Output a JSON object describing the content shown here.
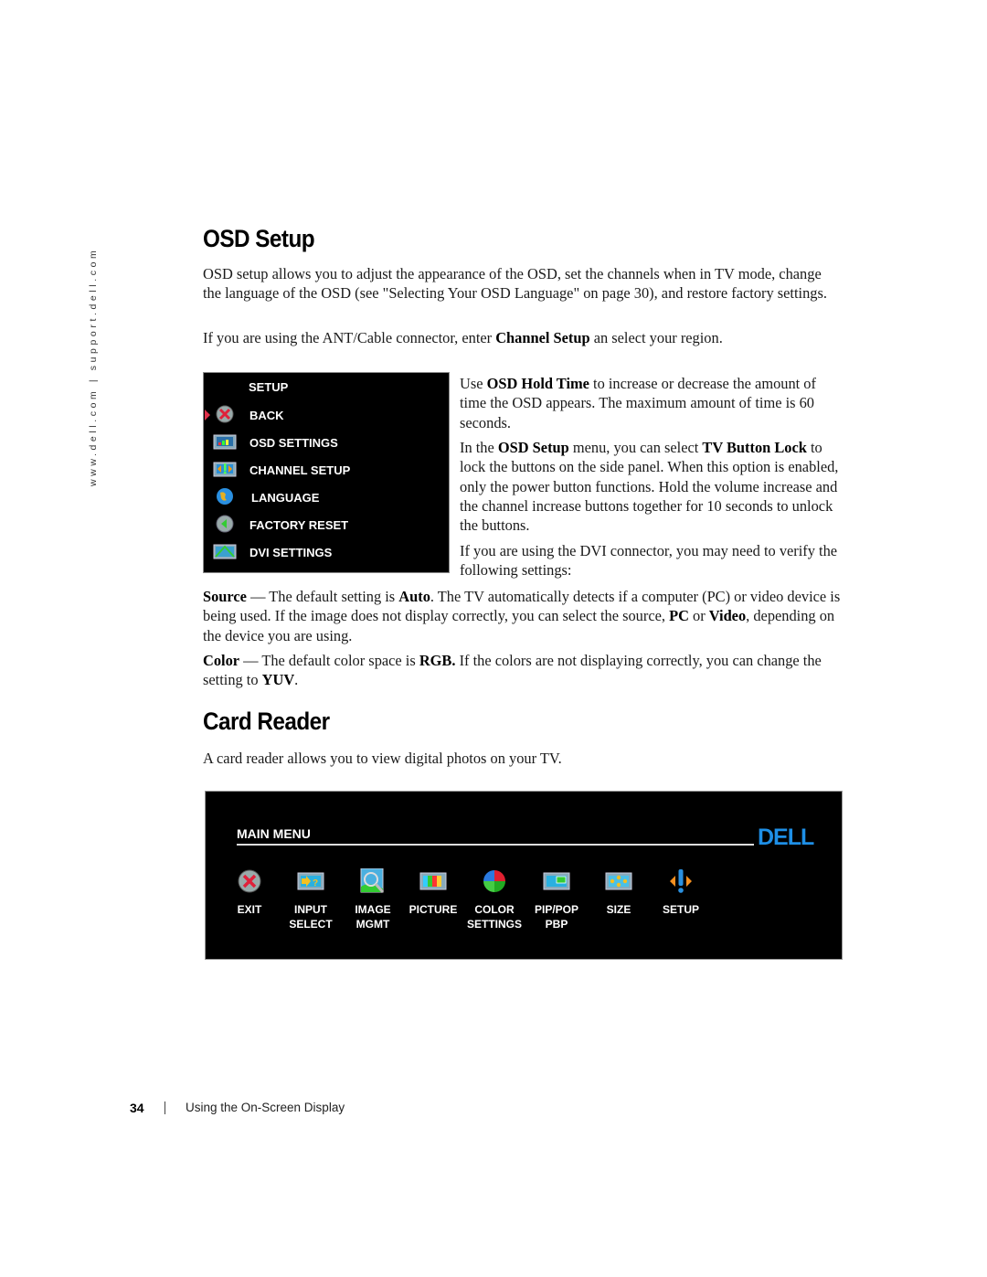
{
  "sidebar": {
    "url_text": "www.dell.com | support.dell.com"
  },
  "osd_setup": {
    "heading": "OSD Setup",
    "intro": "OSD setup allows you to adjust the appearance of the OSD, set the channels when in TV mode, change the language of the OSD (see \"Selecting Your OSD Language\" on page 30), and restore factory settings.",
    "ant_cable": {
      "pre": "If you are using the ANT/Cable connector, enter ",
      "bold": "Channel Setup",
      "post": " an select your region."
    },
    "menu": {
      "title": "SETUP",
      "items": [
        {
          "label": "BACK",
          "icon": "back-x-icon",
          "selected": true
        },
        {
          "label": "OSD SETTINGS",
          "icon": "osd-settings-icon"
        },
        {
          "label": "CHANNEL SETUP",
          "icon": "channel-setup-icon"
        },
        {
          "label": "LANGUAGE",
          "icon": "globe-icon"
        },
        {
          "label": "FACTORY RESET",
          "icon": "factory-reset-icon"
        },
        {
          "label": "DVI SETTINGS",
          "icon": "dvi-settings-icon"
        }
      ]
    },
    "hold_time": {
      "pre": "Use ",
      "bold": "OSD Hold Time",
      "post": " to increase or decrease the amount of time the OSD appears. The maximum amount of time is 60 seconds."
    },
    "button_lock": {
      "pre": "In the ",
      "bold1": "OSD Setup",
      "mid": " menu, you can select ",
      "bold2": "TV Button Lock",
      "post": " to lock the buttons on the side panel. When this option is enabled, only the power button functions. Hold the volume increase and the channel increase buttons together for 10 seconds to unlock the buttons."
    },
    "dvi_note": "If you are using the DVI connector, you may need to verify the following settings:",
    "source": {
      "label": "Source",
      "t1": " — The default setting is ",
      "b1": "Auto",
      "t2": ". The TV automatically detects if a computer (PC) or video device is being used. If the image does not display correctly, you can select the source, ",
      "b2": "PC",
      "t3": " or ",
      "b3": "Video",
      "t4": ", depending on the device you are using."
    },
    "color": {
      "label": "Color",
      "t1": " — The default color space is ",
      "b1": "RGB.",
      "t2": " If the colors are not displaying correctly, you can change the setting to ",
      "b2": "YUV",
      "t3": "."
    }
  },
  "card_reader": {
    "heading": "Card Reader",
    "intro": "A card reader allows you to view digital photos on your TV.",
    "main_menu": {
      "title": "MAIN MENU",
      "logo": "DELL",
      "logo_color": "#1e8fe6",
      "items": [
        {
          "label": "EXIT",
          "icon": "exit-icon"
        },
        {
          "label": "INPUT\nSELECT",
          "icon": "input-select-icon"
        },
        {
          "label": "IMAGE\nMGMT",
          "icon": "image-mgmt-icon"
        },
        {
          "label": "PICTURE",
          "icon": "picture-icon"
        },
        {
          "label": "COLOR\nSETTINGS",
          "icon": "color-settings-icon"
        },
        {
          "label": "PIP/POP\nPBP",
          "icon": "pip-pop-icon"
        },
        {
          "label": "SIZE",
          "icon": "size-icon"
        },
        {
          "label": "SETUP",
          "icon": "setup-icon"
        }
      ]
    }
  },
  "footer": {
    "page_number": "34",
    "section": "Using the On-Screen Display"
  }
}
